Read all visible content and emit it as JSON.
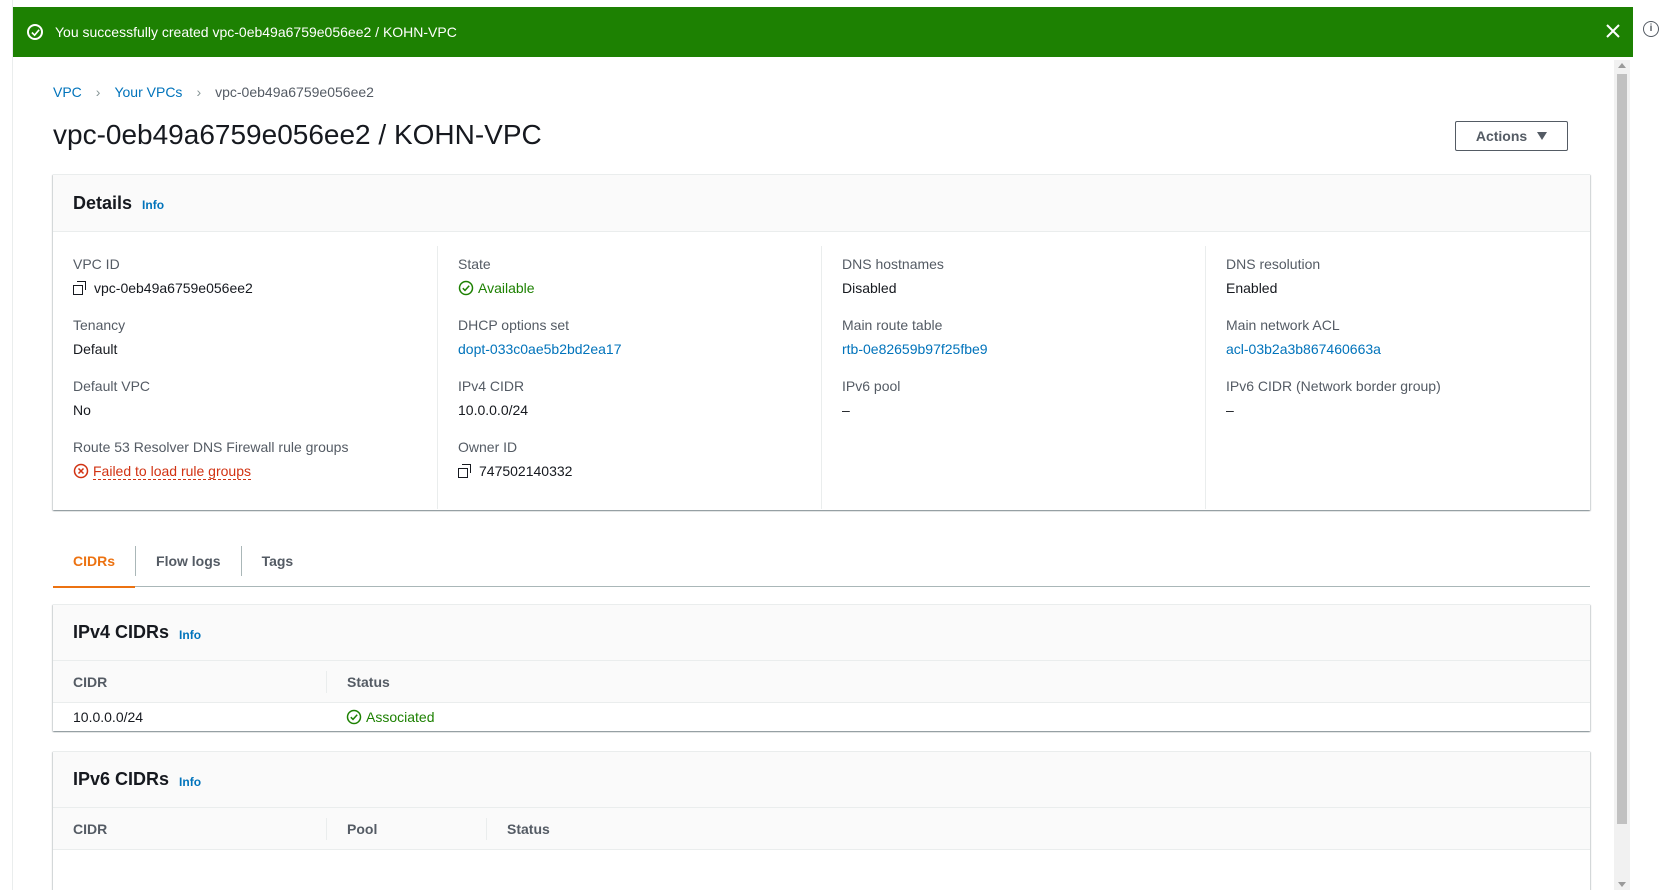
{
  "flash": {
    "message": "You successfully created vpc-0eb49a6759e056ee2 / KOHN-VPC"
  },
  "breadcrumb": {
    "items": [
      "VPC",
      "Your VPCs"
    ],
    "current": "vpc-0eb49a6759e056ee2"
  },
  "page": {
    "title": "vpc-0eb49a6759e056ee2 / KOHN-VPC",
    "actions_label": "Actions"
  },
  "details": {
    "title": "Details",
    "info": "Info",
    "col1": {
      "vpc_id_label": "VPC ID",
      "vpc_id_value": "vpc-0eb49a6759e056ee2",
      "tenancy_label": "Tenancy",
      "tenancy_value": "Default",
      "default_vpc_label": "Default VPC",
      "default_vpc_value": "No",
      "route53_label": "Route 53 Resolver DNS Firewall rule groups",
      "route53_value": "Failed to load rule groups"
    },
    "col2": {
      "state_label": "State",
      "state_value": "Available",
      "dhcp_label": "DHCP options set",
      "dhcp_value": "dopt-033c0ae5b2bd2ea17",
      "ipv4_cidr_label": "IPv4 CIDR",
      "ipv4_cidr_value": "10.0.0.0/24",
      "owner_label": "Owner ID",
      "owner_value": "747502140332"
    },
    "col3": {
      "dns_hostnames_label": "DNS hostnames",
      "dns_hostnames_value": "Disabled",
      "route_table_label": "Main route table",
      "route_table_value": "rtb-0e82659b97f25fbe9",
      "ipv6_pool_label": "IPv6 pool",
      "ipv6_pool_value": "–"
    },
    "col4": {
      "dns_resolution_label": "DNS resolution",
      "dns_resolution_value": "Enabled",
      "acl_label": "Main network ACL",
      "acl_value": "acl-03b2a3b867460663a",
      "ipv6_cidr_label": "IPv6 CIDR (Network border group)",
      "ipv6_cidr_value": "–"
    }
  },
  "tabs": [
    "CIDRs",
    "Flow logs",
    "Tags"
  ],
  "ipv4_cidrs": {
    "title": "IPv4 CIDRs",
    "info": "Info",
    "columns": [
      "CIDR",
      "Status"
    ],
    "rows": [
      {
        "cidr": "10.0.0.0/24",
        "status": "Associated"
      }
    ]
  },
  "ipv6_cidrs": {
    "title": "IPv6 CIDRs",
    "info": "Info",
    "columns": [
      "CIDR",
      "Pool",
      "Status"
    ]
  },
  "colors": {
    "flash_success": "#1d8102",
    "link": "#0073bb",
    "active_tab": "#ec7211",
    "error": "#d13212",
    "success": "#1d8102"
  }
}
